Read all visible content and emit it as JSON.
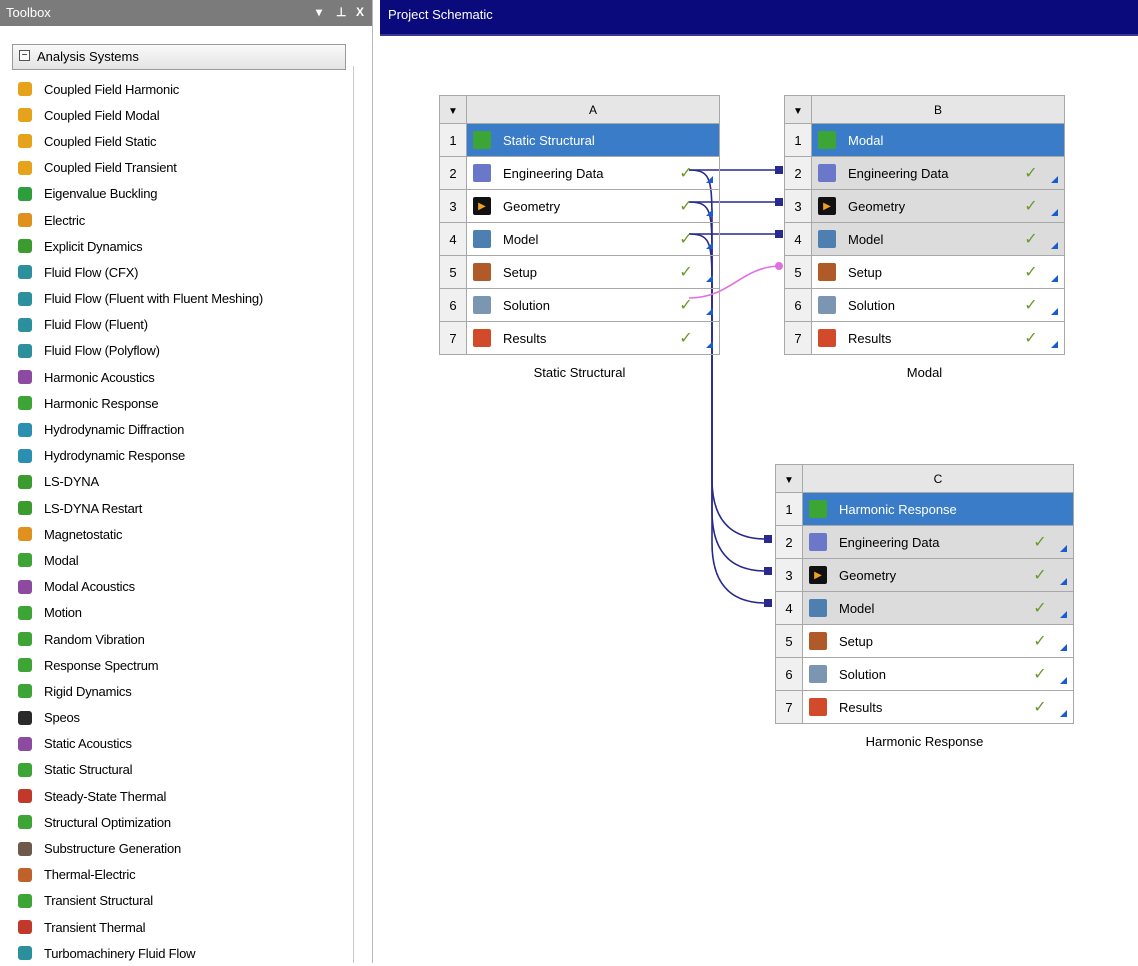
{
  "toolbox": {
    "title": "Toolbox",
    "controls": {
      "dropdown": "▾",
      "pin": "ᵖ",
      "close": "X"
    },
    "section": {
      "toggle": "−",
      "label": "Analysis Systems"
    },
    "items": [
      {
        "label": "Coupled Field Harmonic",
        "icon": "coupled-field-icon",
        "color": "#e6a21a"
      },
      {
        "label": "Coupled Field Modal",
        "icon": "coupled-field-icon",
        "color": "#e6a21a"
      },
      {
        "label": "Coupled Field Static",
        "icon": "coupled-field-icon",
        "color": "#e6a21a"
      },
      {
        "label": "Coupled Field Transient",
        "icon": "coupled-field-icon",
        "color": "#e6a21a"
      },
      {
        "label": "Eigenvalue Buckling",
        "icon": "buckling-icon",
        "color": "#2e9e3c"
      },
      {
        "label": "Electric",
        "icon": "electric-icon",
        "color": "#e0901c"
      },
      {
        "label": "Explicit Dynamics",
        "icon": "explicit-icon",
        "color": "#3b9b2f"
      },
      {
        "label": "Fluid Flow (CFX)",
        "icon": "fluid-flow-icon",
        "color": "#2c8f9c"
      },
      {
        "label": "Fluid Flow (Fluent with Fluent Meshing)",
        "icon": "fluid-flow-icon",
        "color": "#2c8f9c"
      },
      {
        "label": "Fluid Flow (Fluent)",
        "icon": "fluid-flow-icon",
        "color": "#2c8f9c"
      },
      {
        "label": "Fluid Flow (Polyflow)",
        "icon": "fluid-flow-icon",
        "color": "#2c8f9c"
      },
      {
        "label": "Harmonic Acoustics",
        "icon": "acoustics-icon",
        "color": "#8c4aa0"
      },
      {
        "label": "Harmonic Response",
        "icon": "harmonic-icon",
        "color": "#3da536"
      },
      {
        "label": "Hydrodynamic Diffraction",
        "icon": "hydrodynamic-icon",
        "color": "#2a8fb0"
      },
      {
        "label": "Hydrodynamic Response",
        "icon": "hydrodynamic-icon",
        "color": "#2a8fb0"
      },
      {
        "label": "LS-DYNA",
        "icon": "ls-dyna-icon",
        "color": "#3b9b2f"
      },
      {
        "label": "LS-DYNA Restart",
        "icon": "ls-dyna-icon",
        "color": "#3b9b2f"
      },
      {
        "label": "Magnetostatic",
        "icon": "magnet-icon",
        "color": "#e0901c"
      },
      {
        "label": "Modal",
        "icon": "modal-icon",
        "color": "#3da536"
      },
      {
        "label": "Modal Acoustics",
        "icon": "acoustics-icon",
        "color": "#8c4aa0"
      },
      {
        "label": "Motion",
        "icon": "motion-icon",
        "color": "#3da536"
      },
      {
        "label": "Random Vibration",
        "icon": "vibration-icon",
        "color": "#3da536"
      },
      {
        "label": "Response Spectrum",
        "icon": "spectrum-icon",
        "color": "#3da536"
      },
      {
        "label": "Rigid Dynamics",
        "icon": "rigid-icon",
        "color": "#3da536"
      },
      {
        "label": "Speos",
        "icon": "speos-icon",
        "color": "#2a2a2a"
      },
      {
        "label": "Static Acoustics",
        "icon": "acoustics-icon",
        "color": "#8c4aa0"
      },
      {
        "label": "Static Structural",
        "icon": "structural-icon",
        "color": "#3da536"
      },
      {
        "label": "Steady-State Thermal",
        "icon": "thermal-icon",
        "color": "#c0392b"
      },
      {
        "label": "Structural Optimization",
        "icon": "optimization-icon",
        "color": "#3da536"
      },
      {
        "label": "Substructure Generation",
        "icon": "substructure-icon",
        "color": "#6d5a4a"
      },
      {
        "label": "Thermal-Electric",
        "icon": "thermal-electric-icon",
        "color": "#c0602b"
      },
      {
        "label": "Transient Structural",
        "icon": "structural-icon",
        "color": "#3da536"
      },
      {
        "label": "Transient Thermal",
        "icon": "thermal-icon",
        "color": "#c0392b"
      },
      {
        "label": "Turbomachinery Fluid Flow",
        "icon": "fluid-flow-icon",
        "color": "#2c8f9c"
      }
    ]
  },
  "schematic": {
    "title": "Project Schematic",
    "systems": [
      {
        "id": "A",
        "letter": "A",
        "caption": "Static Structural",
        "rows": [
          {
            "num": "1",
            "label": "Static Structural",
            "icon": "static-structural-icon",
            "title": true
          },
          {
            "num": "2",
            "label": "Engineering Data",
            "icon": "engineering-data-icon",
            "status": "✓"
          },
          {
            "num": "3",
            "label": "Geometry",
            "icon": "geometry-icon",
            "status": "✓"
          },
          {
            "num": "4",
            "label": "Model",
            "icon": "model-icon",
            "status": "✓"
          },
          {
            "num": "5",
            "label": "Setup",
            "icon": "setup-icon",
            "status": "✓"
          },
          {
            "num": "6",
            "label": "Solution",
            "icon": "solution-icon",
            "status": "✓"
          },
          {
            "num": "7",
            "label": "Results",
            "icon": "results-icon",
            "status": "✓"
          }
        ]
      },
      {
        "id": "B",
        "letter": "B",
        "caption": "Modal",
        "rows": [
          {
            "num": "1",
            "label": "Modal",
            "icon": "modal-icon",
            "title": true
          },
          {
            "num": "2",
            "label": "Engineering Data",
            "icon": "engineering-data-icon",
            "status": "✓",
            "shared": true
          },
          {
            "num": "3",
            "label": "Geometry",
            "icon": "geometry-icon",
            "status": "✓",
            "shared": true
          },
          {
            "num": "4",
            "label": "Model",
            "icon": "model-icon",
            "status": "✓",
            "shared": true
          },
          {
            "num": "5",
            "label": "Setup",
            "icon": "setup-icon",
            "status": "✓"
          },
          {
            "num": "6",
            "label": "Solution",
            "icon": "solution-icon",
            "status": "✓"
          },
          {
            "num": "7",
            "label": "Results",
            "icon": "results-icon",
            "status": "✓"
          }
        ]
      },
      {
        "id": "C",
        "letter": "C",
        "caption": "Harmonic Response",
        "rows": [
          {
            "num": "1",
            "label": "Harmonic Response",
            "icon": "harmonic-response-icon",
            "title": true
          },
          {
            "num": "2",
            "label": "Engineering Data",
            "icon": "engineering-data-icon",
            "status": "✓",
            "shared": true
          },
          {
            "num": "3",
            "label": "Geometry",
            "icon": "geometry-icon",
            "status": "✓",
            "shared": true
          },
          {
            "num": "4",
            "label": "Model",
            "icon": "model-icon",
            "status": "✓",
            "shared": true
          },
          {
            "num": "5",
            "label": "Setup",
            "icon": "setup-icon",
            "status": "✓"
          },
          {
            "num": "6",
            "label": "Solution",
            "icon": "solution-icon",
            "status": "✓"
          },
          {
            "num": "7",
            "label": "Results",
            "icon": "results-icon",
            "status": "✓"
          }
        ]
      }
    ],
    "colors": {
      "link": "#2a2a8c",
      "solution_link": "#e070e0",
      "title_row": "#3a7cc7",
      "header_bar": "#0a0a7c",
      "check": "#6a9a2c",
      "tri": "#1a5ccf"
    }
  }
}
